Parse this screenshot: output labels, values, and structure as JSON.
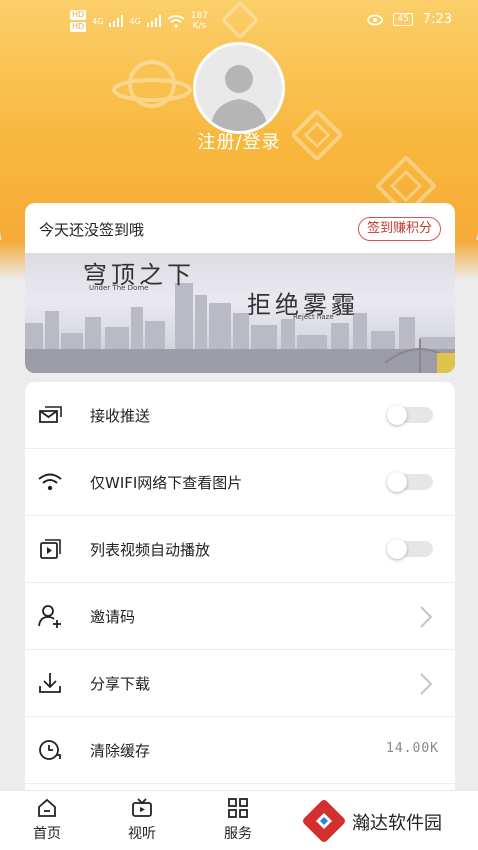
{
  "status": {
    "left_badges": [
      "HD",
      "HD"
    ],
    "network_1": "4G",
    "network_2": "4G",
    "speed_value": "187",
    "speed_unit": "K/s",
    "battery": "45",
    "time": "7:23"
  },
  "profile": {
    "login_label": "注册/登录"
  },
  "signin": {
    "message": "今天还没签到哦",
    "button_label": "签到赚积分",
    "banner_title_1": "穹顶之下",
    "banner_sub_1": "Under The Dome",
    "banner_title_2": "拒绝雾霾",
    "banner_sub_2": "Reject haze"
  },
  "settings": {
    "items": [
      {
        "label": "接收推送",
        "icon": "envelope-icon",
        "control": "toggle",
        "on": false
      },
      {
        "label": "仅WIFI网络下查看图片",
        "icon": "wifi-icon",
        "control": "toggle",
        "on": false
      },
      {
        "label": "列表视频自动播放",
        "icon": "video-play-icon",
        "control": "toggle",
        "on": false
      },
      {
        "label": "邀请码",
        "icon": "add-user-icon",
        "control": "chevron"
      },
      {
        "label": "分享下载",
        "icon": "download-icon",
        "control": "chevron"
      },
      {
        "label": "清除缓存",
        "icon": "clear-cache-icon",
        "control": "value",
        "value": "14.00K"
      }
    ]
  },
  "tabs": [
    {
      "label": "首页",
      "icon": "home-icon"
    },
    {
      "label": "视听",
      "icon": "tv-icon"
    },
    {
      "label": "服务",
      "icon": "grid-icon"
    }
  ],
  "watermark": {
    "text": "瀚达软件园"
  },
  "colors": {
    "hero_top": "#fbcf6a",
    "hero_bottom": "#f6a935",
    "signin_button": "#d9534f"
  }
}
